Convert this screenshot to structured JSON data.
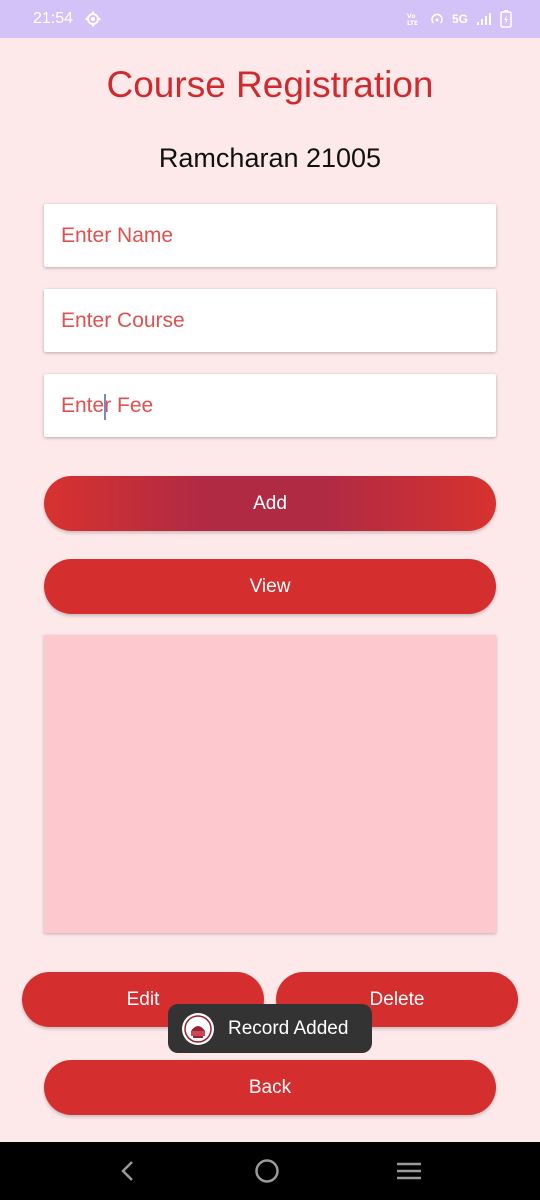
{
  "status_bar": {
    "time": "21:54",
    "network": "5G",
    "icons": [
      "settings-gear-icon",
      "volte-icon",
      "hotspot-icon",
      "signal-icon",
      "battery-charging-icon"
    ]
  },
  "header": {
    "title": "Course Registration",
    "subtitle": "Ramcharan 21005"
  },
  "form": {
    "name_placeholder": "Enter Name",
    "course_placeholder": "Enter Course",
    "fee_placeholder": "Enter Fee"
  },
  "buttons": {
    "add": "Add",
    "view": "View",
    "edit": "Edit",
    "delete": "Delete",
    "back": "Back"
  },
  "toast": {
    "message": "Record Added",
    "icon": "app-logo-icon"
  },
  "nav_bar": {
    "icons": [
      "back-chevron-icon",
      "home-circle-icon",
      "recents-menu-icon"
    ]
  },
  "colors": {
    "accent": "#d52e2f",
    "background": "#fde8ea",
    "records_panel": "#fdc9ce",
    "status_bar": "#d2c2f7"
  }
}
